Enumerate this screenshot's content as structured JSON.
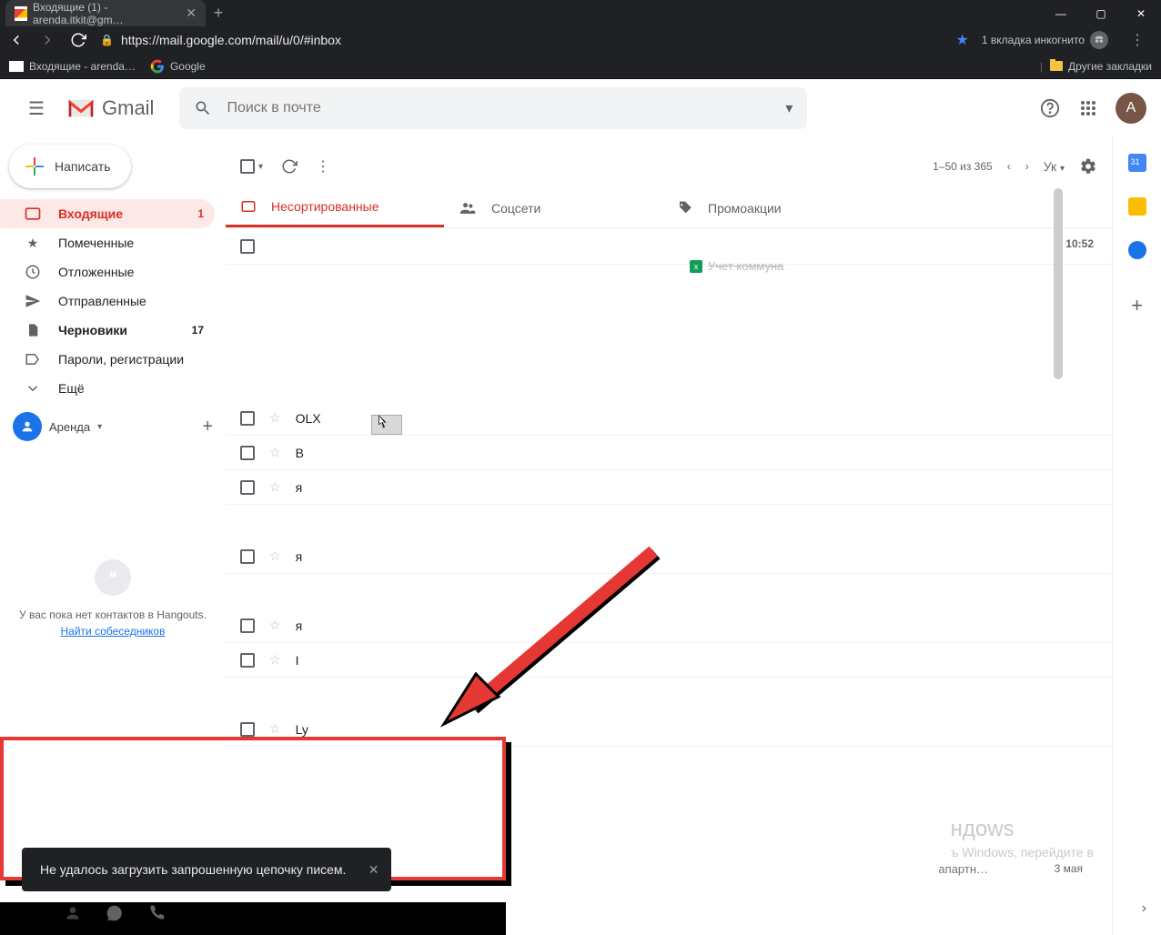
{
  "browser": {
    "tab_title": "Входящие (1) - arenda.itkit@gm…",
    "url": "https://mail.google.com/mail/u/0/#inbox",
    "incognito_label": "1 вкладка инкогнито",
    "bookmarks": {
      "b1": "Входящие - arenda…",
      "b2": "Google",
      "other": "Другие закладки"
    }
  },
  "header": {
    "logo_text": "Gmail",
    "search_placeholder": "Поиск в почте",
    "avatar_letter": "А"
  },
  "compose_label": "Написать",
  "nav": {
    "inbox": {
      "label": "Входящие",
      "count": "1"
    },
    "starred": {
      "label": "Помеченные"
    },
    "snoozed": {
      "label": "Отложенные"
    },
    "sent": {
      "label": "Отправленные"
    },
    "drafts": {
      "label": "Черновики",
      "count": "17"
    },
    "passwords": {
      "label": "Пароли, регистрации"
    },
    "more": {
      "label": "Ещё"
    }
  },
  "hangouts": {
    "user": "Аренда",
    "msg1": "У вас пока нет контактов в Hangouts.",
    "link": "Найти собеседников"
  },
  "toolbar": {
    "range": "1–50 из 365",
    "lang": "Ук"
  },
  "tabs": {
    "primary": "Несортированные",
    "social": "Соцсети",
    "promo": "Промоакции"
  },
  "list": {
    "time": "10:52",
    "attach": "Учет коммуна",
    "r_olx": "OLX",
    "r_b": "В",
    "r_ya": "я",
    "r_i": "I",
    "r_ly": "Ly",
    "bottom_tag": "апартн…",
    "bottom_date": "3 мая"
  },
  "watermark": {
    "t": "ндows",
    "s1": "ъ Windows, перейдите в"
  },
  "snackbar": {
    "text": "Не удалось загрузить запрошенную цепочку писем."
  }
}
